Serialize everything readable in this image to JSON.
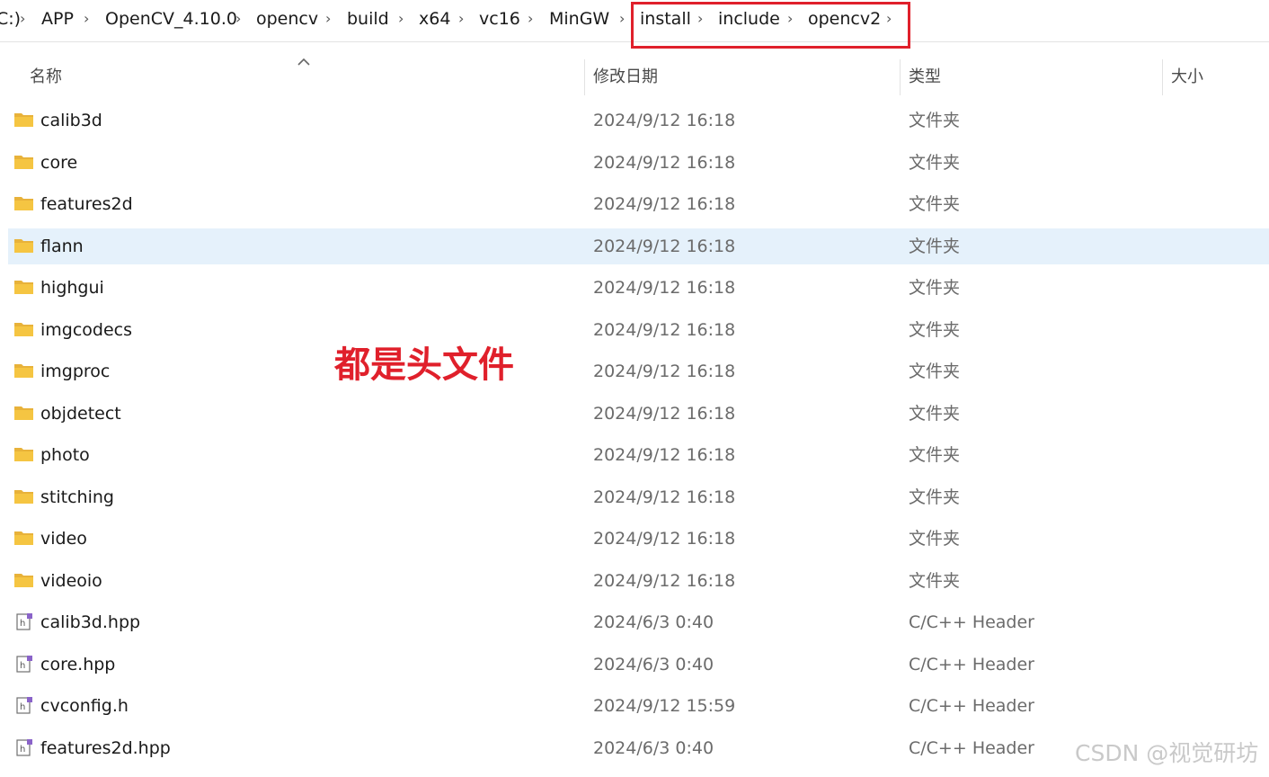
{
  "breadcrumb": {
    "items": [
      "C:)",
      "APP",
      "OpenCV_4.10.0",
      "opencv",
      "build",
      "x64",
      "vc16",
      "MinGW",
      "install",
      "include",
      "opencv2"
    ],
    "separator": "›",
    "highlight_color": "#e0202b"
  },
  "columns": {
    "name": "名称",
    "date": "修改日期",
    "type": "类型",
    "size": "大小"
  },
  "files": [
    {
      "name": "calib3d",
      "date": "2024/9/12 16:18",
      "type": "文件夹",
      "kind": "folder"
    },
    {
      "name": "core",
      "date": "2024/9/12 16:18",
      "type": "文件夹",
      "kind": "folder"
    },
    {
      "name": "features2d",
      "date": "2024/9/12 16:18",
      "type": "文件夹",
      "kind": "folder"
    },
    {
      "name": "flann",
      "date": "2024/9/12 16:18",
      "type": "文件夹",
      "kind": "folder",
      "selected": true
    },
    {
      "name": "highgui",
      "date": "2024/9/12 16:18",
      "type": "文件夹",
      "kind": "folder"
    },
    {
      "name": "imgcodecs",
      "date": "2024/9/12 16:18",
      "type": "文件夹",
      "kind": "folder"
    },
    {
      "name": "imgproc",
      "date": "2024/9/12 16:18",
      "type": "文件夹",
      "kind": "folder"
    },
    {
      "name": "objdetect",
      "date": "2024/9/12 16:18",
      "type": "文件夹",
      "kind": "folder"
    },
    {
      "name": "photo",
      "date": "2024/9/12 16:18",
      "type": "文件夹",
      "kind": "folder"
    },
    {
      "name": "stitching",
      "date": "2024/9/12 16:18",
      "type": "文件夹",
      "kind": "folder"
    },
    {
      "name": "video",
      "date": "2024/9/12 16:18",
      "type": "文件夹",
      "kind": "folder"
    },
    {
      "name": "videoio",
      "date": "2024/9/12 16:18",
      "type": "文件夹",
      "kind": "folder"
    },
    {
      "name": "calib3d.hpp",
      "date": "2024/6/3 0:40",
      "type": "C/C++ Header",
      "kind": "header"
    },
    {
      "name": "core.hpp",
      "date": "2024/6/3 0:40",
      "type": "C/C++ Header",
      "kind": "header"
    },
    {
      "name": "cvconfig.h",
      "date": "2024/9/12 15:59",
      "type": "C/C++ Header",
      "kind": "header"
    },
    {
      "name": "features2d.hpp",
      "date": "2024/6/3 0:40",
      "type": "C/C++ Header",
      "kind": "header"
    }
  ],
  "annotation": {
    "text": "都是头文件",
    "color": "#e0202b"
  },
  "watermark": "CSDN @视觉研坊",
  "colors": {
    "folder": "#f5c542",
    "selected_row": "#e5f1fb"
  }
}
